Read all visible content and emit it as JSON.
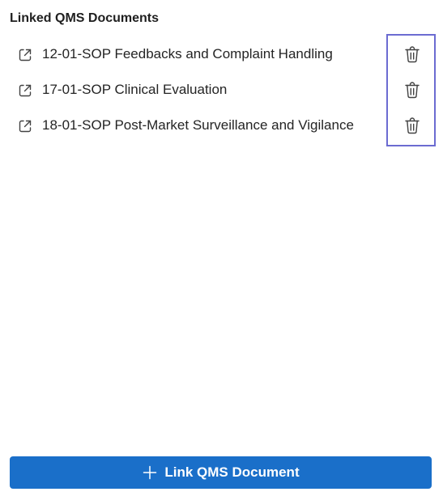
{
  "panel": {
    "title": "Linked QMS Documents"
  },
  "documents": [
    {
      "label": "12-01-SOP Feedbacks and Complaint Handling",
      "open_icon": "open-in-new-icon",
      "delete_icon": "trash-icon"
    },
    {
      "label": "17-01-SOP Clinical Evaluation",
      "open_icon": "open-in-new-icon",
      "delete_icon": "trash-icon"
    },
    {
      "label": "18-01-SOP Post-Market Surveillance and Vigilance",
      "open_icon": "open-in-new-icon",
      "delete_icon": "trash-icon"
    }
  ],
  "footer": {
    "link_button_label": "Link QMS Document",
    "link_button_icon": "plus-icon"
  },
  "colors": {
    "primary": "#1a6fc9",
    "highlight": "#6b6bd1",
    "text": "#242424"
  }
}
